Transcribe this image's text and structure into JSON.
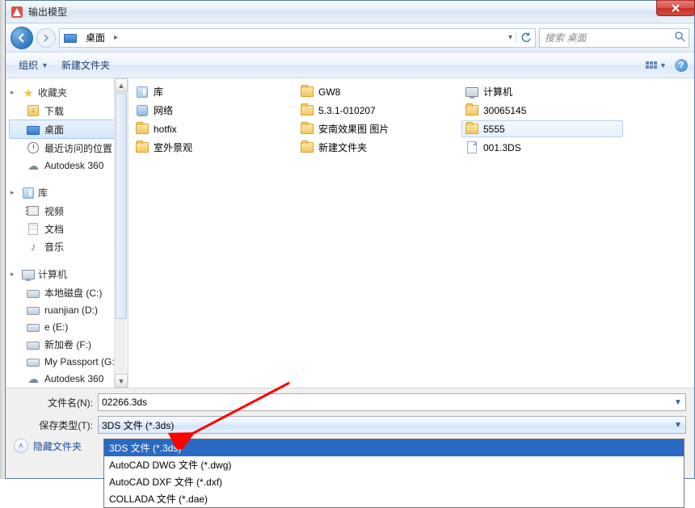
{
  "title": "输出模型",
  "breadcrumb": {
    "location": "桌面"
  },
  "search": {
    "placeholder": "搜索 桌面"
  },
  "toolbar": {
    "organize": "组织",
    "new_folder": "新建文件夹"
  },
  "sidebar": {
    "fav_head": "收藏夹",
    "fav_items": [
      "下载",
      "桌面",
      "最近访问的位置",
      "Autodesk 360"
    ],
    "lib_head": "库",
    "lib_items": [
      "视频",
      "文档",
      "音乐"
    ],
    "comp_head": "计算机",
    "comp_items": [
      "本地磁盘 (C:)",
      "ruanjian (D:)",
      "e (E:)",
      "新加卷 (F:)",
      "My Passport (G:)",
      "Autodesk 360"
    ]
  },
  "files": [
    {
      "name": "库",
      "icon": "lib"
    },
    {
      "name": "GW8",
      "icon": "folder-green"
    },
    {
      "name": "计算机",
      "icon": "computer"
    },
    {
      "name": "网络",
      "icon": "net"
    },
    {
      "name": "5.3.1-010207",
      "icon": "folder"
    },
    {
      "name": "30065145",
      "icon": "folder"
    },
    {
      "name": "hotfix",
      "icon": "folder"
    },
    {
      "name": "安南效果图 图片",
      "icon": "folder"
    },
    {
      "name": "5555",
      "icon": "folder",
      "sel": true
    },
    {
      "name": "室外景观",
      "icon": "folder"
    },
    {
      "name": "新建文件夹",
      "icon": "folder"
    },
    {
      "name": "001.3DS",
      "icon": "file"
    }
  ],
  "bottom": {
    "filename_label": "文件名(N):",
    "filename_value": "02266.3ds",
    "savetype_label": "保存类型(T):",
    "savetype_value": "3DS 文件 (*.3ds)",
    "hide_folders": "隐藏文件夹"
  },
  "dropdown_opts": [
    "3DS 文件 (*.3ds)",
    "AutoCAD DWG 文件 (*.dwg)",
    "AutoCAD DXF 文件 (*.dxf)",
    "COLLADA 文件 (*.dae)"
  ]
}
